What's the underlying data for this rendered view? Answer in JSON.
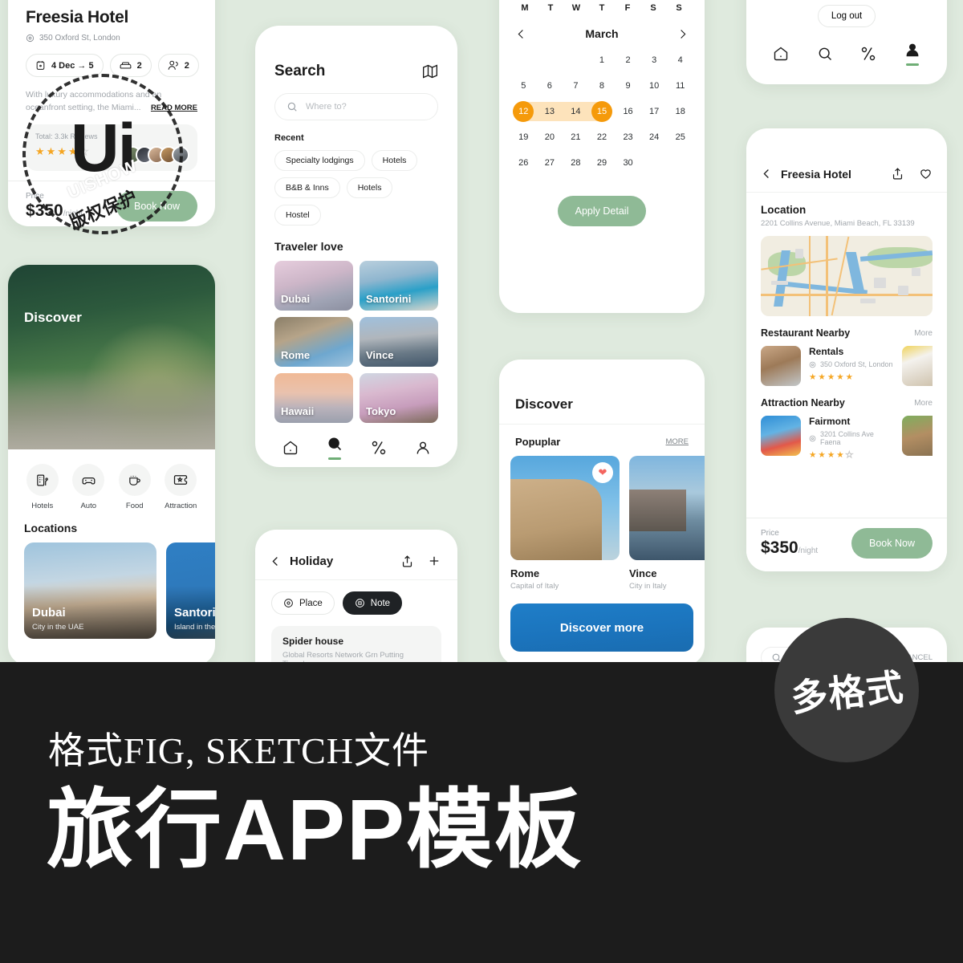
{
  "hotel_card": {
    "title": "Freesia Hotel",
    "address": "350 Oxford St, London",
    "chips": [
      {
        "icon": "calendar-icon",
        "label": "4 Dec → 5"
      },
      {
        "icon": "bed-icon",
        "label": "2"
      },
      {
        "icon": "guests-icon",
        "label": "2"
      }
    ],
    "description": "With luxury accommodations and an oceanfront setting, the Miami...",
    "read_more": "READ MORE",
    "reviews_label": "Total: 3.3k Reviews",
    "rating": 4,
    "rating_max": 5,
    "price_label": "Price",
    "price": "$350",
    "price_unit": "/night",
    "book_label": "Book Now"
  },
  "discover_panel": {
    "hero_label": "Discover",
    "categories": [
      {
        "icon": "hotel-icon",
        "label": "Hotels"
      },
      {
        "icon": "car-icon",
        "label": "Auto"
      },
      {
        "icon": "coffee-icon",
        "label": "Food"
      },
      {
        "icon": "ticket-icon",
        "label": "Attraction"
      }
    ],
    "locations_title": "Locations",
    "locations": [
      {
        "name": "Dubai",
        "caption": "City in the UAE"
      },
      {
        "name": "Santorini",
        "caption": "Island in the Aegean Sea"
      }
    ]
  },
  "search_panel": {
    "title": "Search",
    "map_icon": "map-icon",
    "search_placeholder": "Where to?",
    "search_value": "",
    "recent_label": "Recent",
    "recent_chips": [
      "Specialty lodgings",
      "Hotels",
      "B&B & Inns",
      "Hotels",
      "Hostel"
    ],
    "traveler_title": "Traveler love",
    "traveler_cards": [
      "Dubai",
      "Santorini",
      "Rome",
      "Vince",
      "Hawaii",
      "Tokyo"
    ],
    "tabs": [
      "home-icon",
      "search-icon",
      "route-icon",
      "profile-icon"
    ],
    "active_tab": 1
  },
  "holiday_panel": {
    "title": "Holiday",
    "share_icon": "share-icon",
    "add_icon": "plus-icon",
    "toggles": [
      {
        "icon": "place-icon",
        "label": "Place",
        "active": false
      },
      {
        "icon": "note-icon",
        "label": "Note",
        "active": true
      }
    ],
    "note": {
      "title": "Spider house",
      "text": "Global Resorts Network Grn Putting Timeshares..."
    }
  },
  "calendar_panel": {
    "weekdays": [
      "M",
      "T",
      "W",
      "T",
      "F",
      "S",
      "S"
    ],
    "prev_icon": "chevron-left-icon",
    "next_icon": "chevron-right-icon",
    "month": "March",
    "lead_blanks": 3,
    "days": [
      1,
      2,
      3,
      4,
      5,
      6,
      7,
      8,
      9,
      10,
      11,
      12,
      13,
      14,
      15,
      16,
      17,
      18,
      19,
      20,
      21,
      22,
      23,
      24,
      25,
      26,
      27,
      28,
      29,
      30
    ],
    "range_start": 12,
    "range_end": 15,
    "apply_label": "Apply Detail"
  },
  "discover2_panel": {
    "title": "Discover",
    "section_label": "Popuplar",
    "more_label": "MORE",
    "cards": [
      {
        "name": "Rome",
        "caption": "Capital of Italy",
        "liked": true
      },
      {
        "name": "Vince",
        "caption": "City in Italy",
        "liked": false
      }
    ],
    "banner_label": "Discover more"
  },
  "account_panel": {
    "logout_label": "Log out",
    "tabs": [
      "home-icon",
      "search-icon",
      "route-icon",
      "profile-icon"
    ],
    "active_tab": 3
  },
  "detail_panel": {
    "back_icon": "chevron-left-icon",
    "title": "Freesia Hotel",
    "share_icon": "share-icon",
    "favorite_icon": "heart-outline-icon",
    "location_title": "Location",
    "location_address": "2201 Collins Avenue, Miami Beach, FL 33139",
    "sections": [
      {
        "title": "Restaurant Nearby",
        "more": "More",
        "item": {
          "name": "Rentals",
          "address": "350 Oxford St, London",
          "rating": 5,
          "rating_max": 5
        }
      },
      {
        "title": "Attraction Nearby",
        "more": "More",
        "item": {
          "name": "Fairmont",
          "address": "3201 Collins Ave Faena",
          "rating": 4,
          "rating_max": 5
        }
      }
    ],
    "price_label": "Price",
    "price": "$350",
    "price_unit": "/night",
    "book_label": "Book Now"
  },
  "partial_panel": {
    "search_icon": "search-icon",
    "cancel_label": "CANCEL"
  },
  "watermark": {
    "logo": "Ui",
    "brand": "UISHOW",
    "note": "版权保护"
  },
  "banner": {
    "subtitle": "格式FIG, SKETCH文件",
    "title": "旅行APP模板",
    "badge": "多格式"
  },
  "colors": {
    "background": "#dfeade",
    "accent_green": "#8fba96",
    "accent_orange": "#f59a0b",
    "range_orange": "#fde3bb",
    "star_yellow": "#f5a623",
    "banner_black": "#1c1c1c"
  }
}
